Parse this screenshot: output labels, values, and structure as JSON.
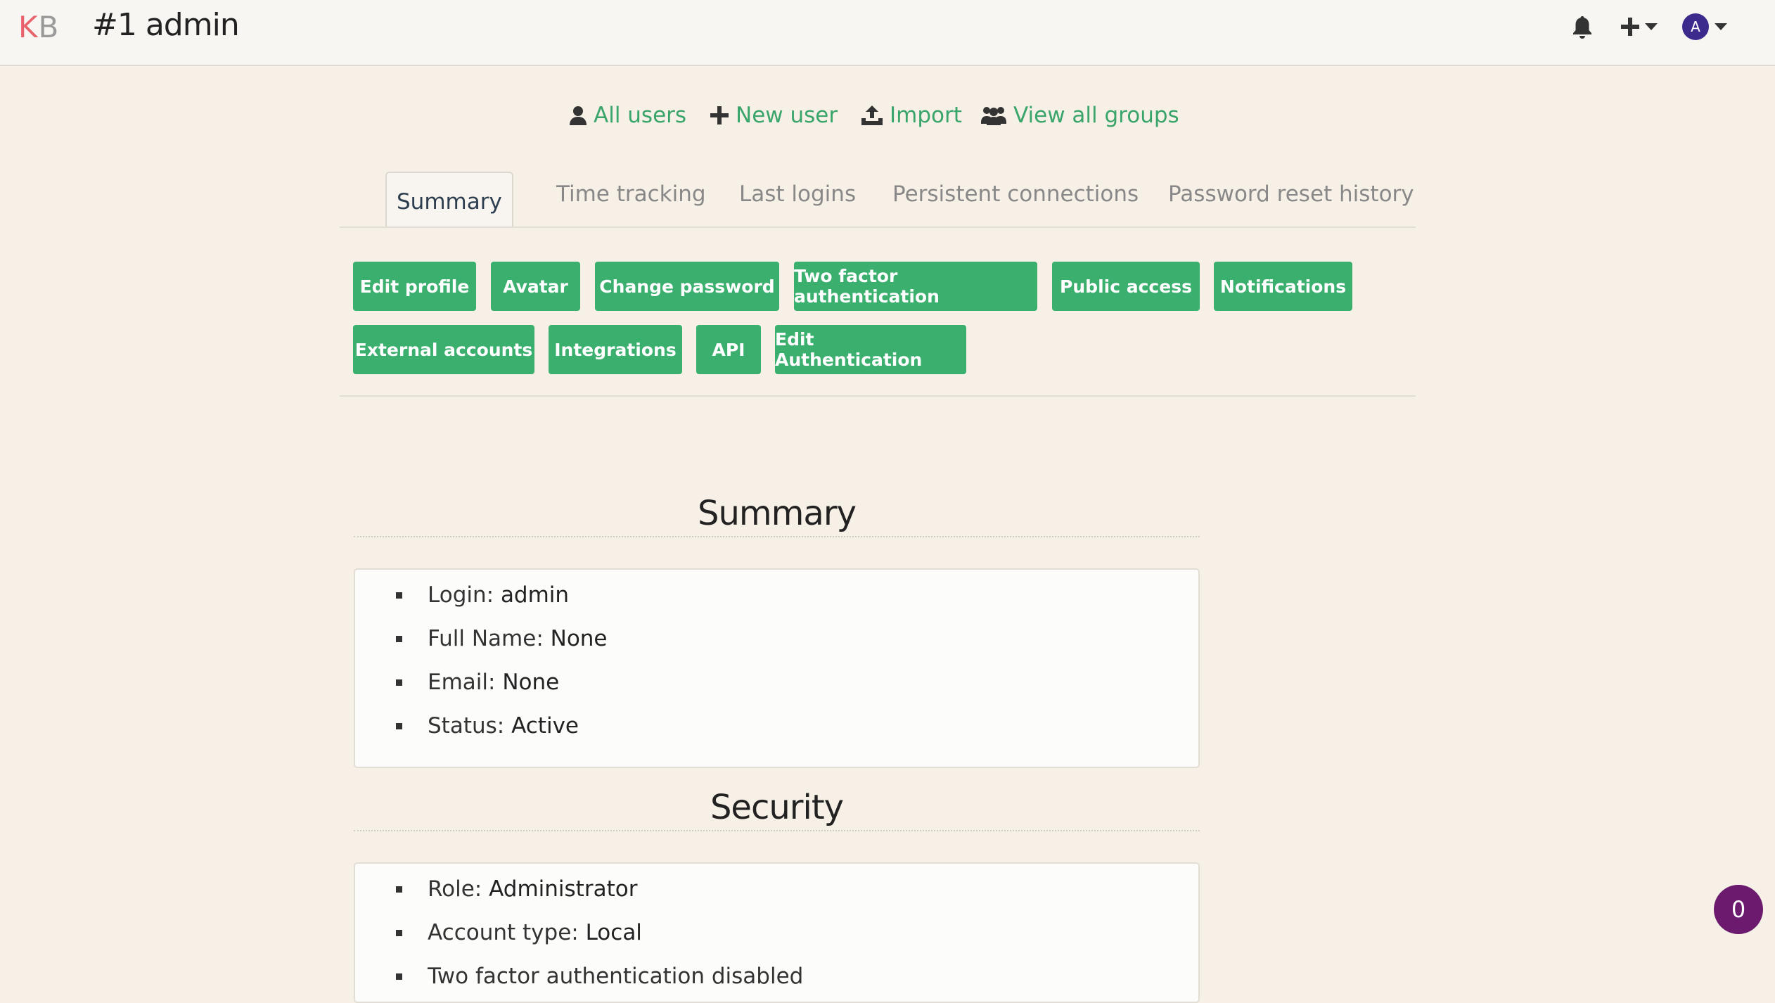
{
  "header": {
    "logo_k": "K",
    "logo_b": "B",
    "title": "#1 admin",
    "avatar_letter": "A"
  },
  "subnav": {
    "all_users": "All users",
    "new_user": "New user",
    "import": "Import",
    "view_all_groups": "View all groups"
  },
  "tabs": [
    "Summary",
    "Time tracking",
    "Last logins",
    "Persistent connections",
    "Password reset history"
  ],
  "actions": [
    "Edit profile",
    "Avatar",
    "Change password",
    "Two factor authentication",
    "Public access",
    "Notifications",
    "External accounts",
    "Integrations",
    "API",
    "Edit Authentication"
  ],
  "summary": {
    "title": "Summary",
    "items": [
      {
        "label": "Login: ",
        "value": "admin"
      },
      {
        "label": "Full Name: ",
        "value": "None"
      },
      {
        "label": "Email: ",
        "value": "None"
      },
      {
        "label": "Status: ",
        "value": "Active"
      }
    ]
  },
  "security": {
    "title": "Security",
    "items": [
      {
        "label": "Role: ",
        "value": "Administrator"
      },
      {
        "label": "Account type: ",
        "value": "Local"
      },
      {
        "label": "Two factor authentication disabled",
        "value": ""
      }
    ]
  },
  "notification_badge": "0",
  "colors": {
    "accent_green": "#3aaf6e",
    "link_green": "#3aa56a",
    "background": "#f7f0e6",
    "badge_purple": "#6b1a6d",
    "avatar_purple": "#3c2a8c"
  }
}
